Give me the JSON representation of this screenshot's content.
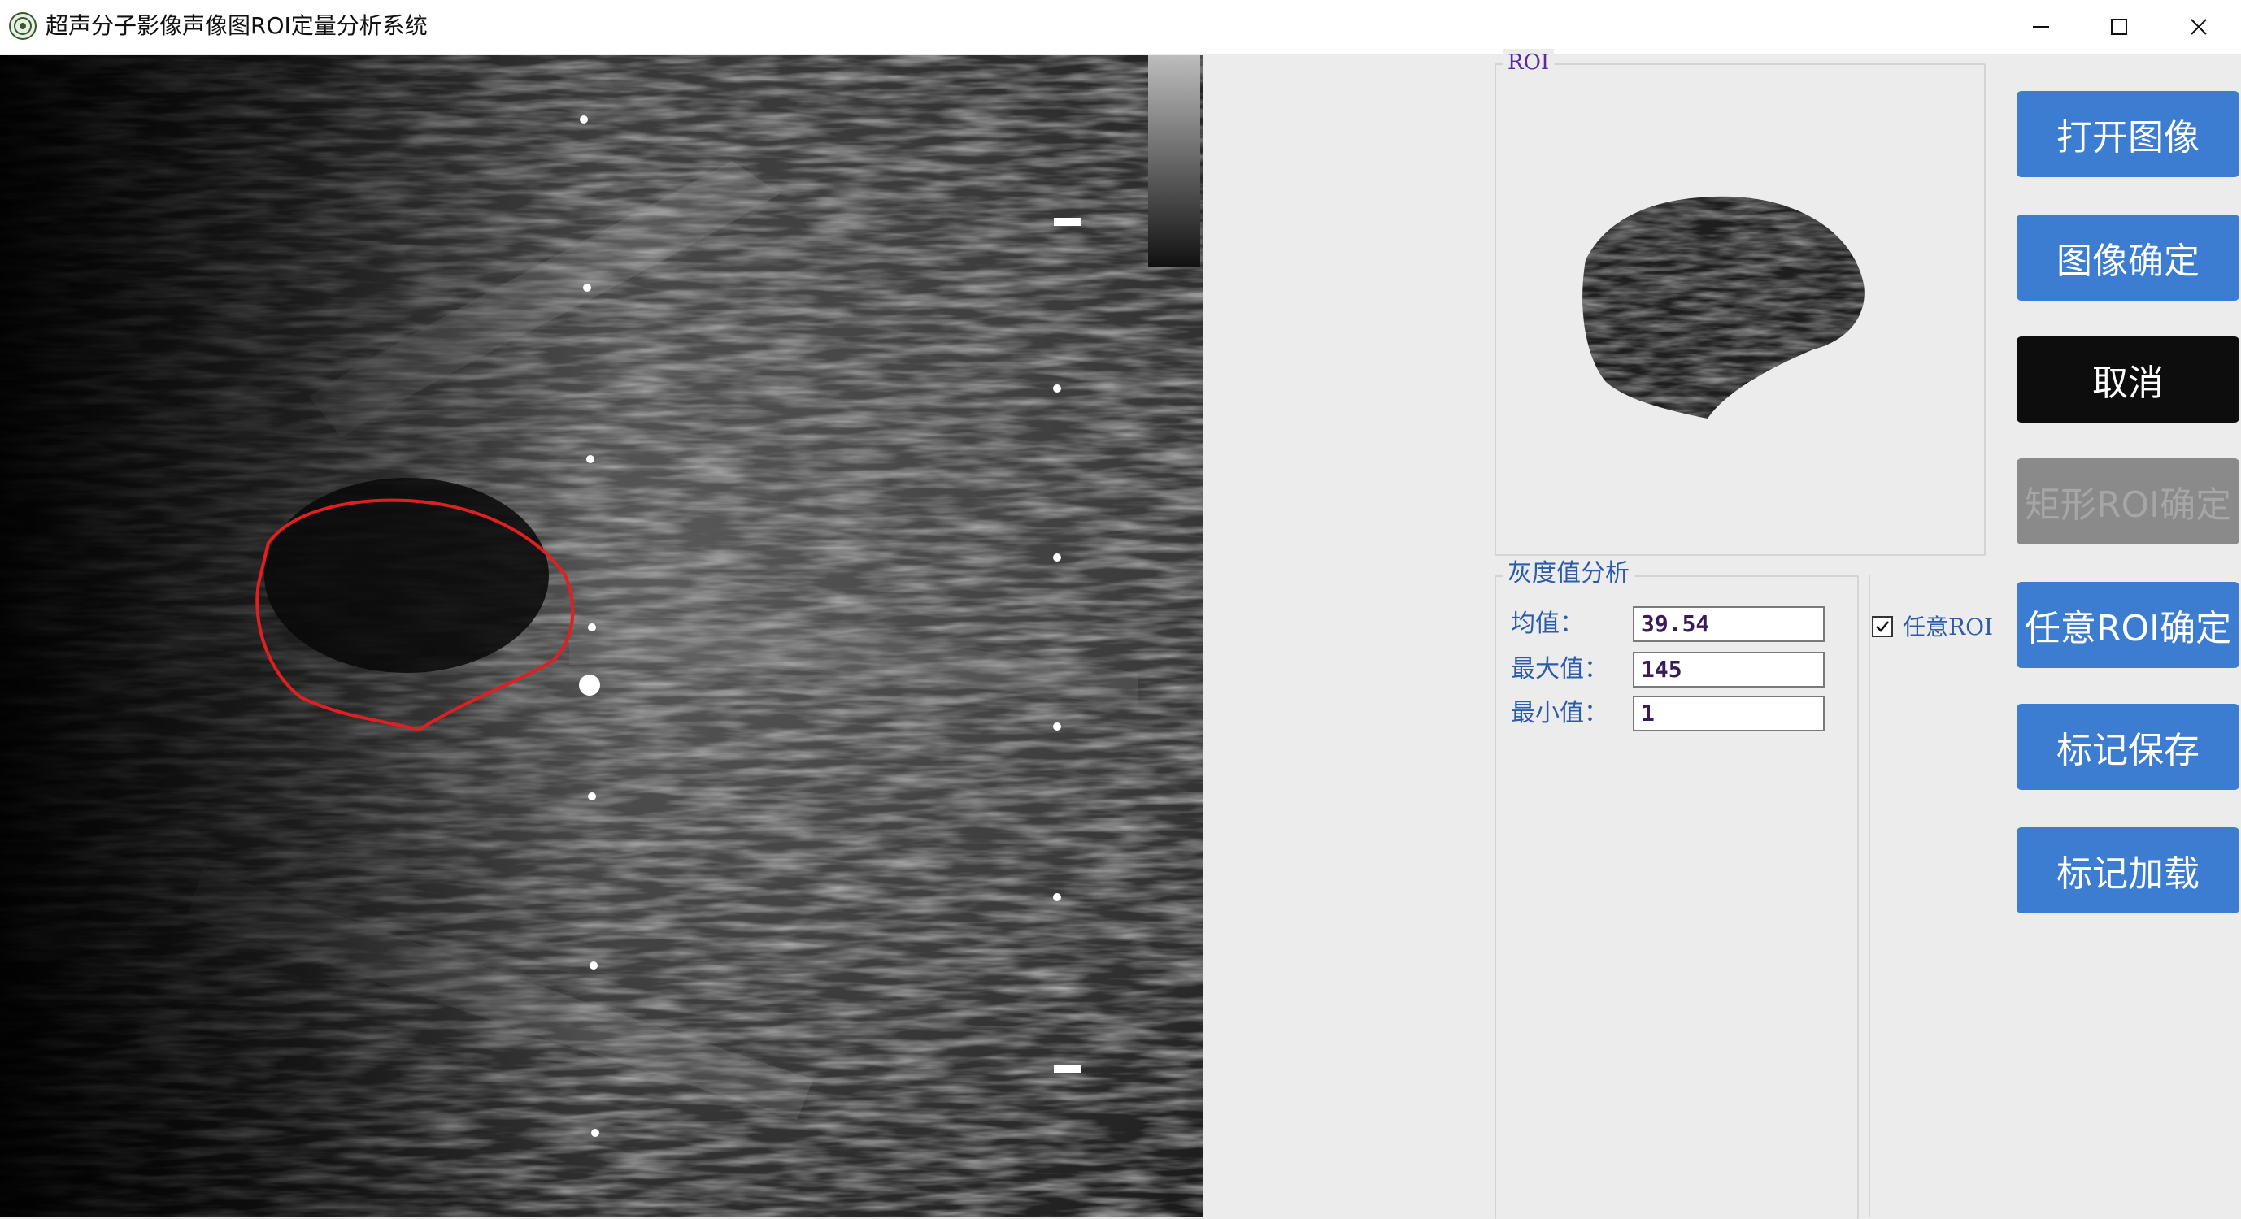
{
  "window": {
    "title": "超声分子影像声像图ROI定量分析系统",
    "controls": {
      "minimize": "minimize",
      "maximize": "maximize",
      "close": "close"
    }
  },
  "roi_group": {
    "legend": "ROI"
  },
  "gray_group": {
    "legend": "灰度值分析",
    "fields": {
      "mean": {
        "label": "均值：",
        "value": "39.54"
      },
      "max": {
        "label": "最大值：",
        "value": "145"
      },
      "min": {
        "label": "最小值：",
        "value": "1"
      }
    }
  },
  "checkbox": {
    "label": "任意ROI",
    "checked": true
  },
  "buttons": {
    "open_image": "打开图像",
    "image_confirm": "图像确定",
    "cancel": "取消",
    "rect_roi_confirm": "矩形ROI确定",
    "free_roi_confirm": "任意ROI确定",
    "mark_save": "标记保存",
    "mark_load": "标记加载"
  },
  "colors": {
    "button_blue": "#3c7dd2",
    "button_black": "#0d0d0d",
    "button_disabled": "#8a8a8a",
    "roi_outline": "#e02020",
    "label_blue": "#2a5caa"
  }
}
